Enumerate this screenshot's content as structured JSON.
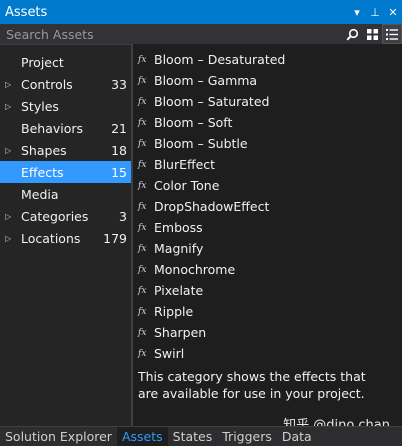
{
  "window": {
    "title": "Assets",
    "controls": {
      "dropdown": "▾",
      "pin": "⊥",
      "close": "✕"
    }
  },
  "search": {
    "placeholder": "Search Assets",
    "value": ""
  },
  "categories": [
    {
      "label": "Project",
      "count": "",
      "expandable": false
    },
    {
      "label": "Controls",
      "count": "33",
      "expandable": true
    },
    {
      "label": "Styles",
      "count": "",
      "expandable": true
    },
    {
      "label": "Behaviors",
      "count": "21",
      "expandable": false
    },
    {
      "label": "Shapes",
      "count": "18",
      "expandable": true
    },
    {
      "label": "Effects",
      "count": "15",
      "expandable": false,
      "selected": true
    },
    {
      "label": "Media",
      "count": "",
      "expandable": false
    },
    {
      "label": "Categories",
      "count": "3",
      "expandable": true
    },
    {
      "label": "Locations",
      "count": "179",
      "expandable": true
    }
  ],
  "effects": {
    "icon_label": "fx",
    "items": [
      "Bloom – Desaturated",
      "Bloom – Gamma",
      "Bloom – Saturated",
      "Bloom – Soft",
      "Bloom – Subtle",
      "BlurEffect",
      "Color Tone",
      "DropShadowEffect",
      "Emboss",
      "Magnify",
      "Monochrome",
      "Pixelate",
      "Ripple",
      "Sharpen",
      "Swirl"
    ],
    "description": "This category shows the effects that are available for use in your project."
  },
  "bottom_tabs": [
    {
      "label": "Solution Explorer",
      "active": false
    },
    {
      "label": "Assets",
      "active": true
    },
    {
      "label": "States",
      "active": false
    },
    {
      "label": "Triggers",
      "active": false
    },
    {
      "label": "Data",
      "active": false
    }
  ],
  "watermark": "知乎 @dino chan",
  "colors": {
    "accent": "#007acc",
    "selection": "#3399ff",
    "background": "#1e1e1e"
  }
}
